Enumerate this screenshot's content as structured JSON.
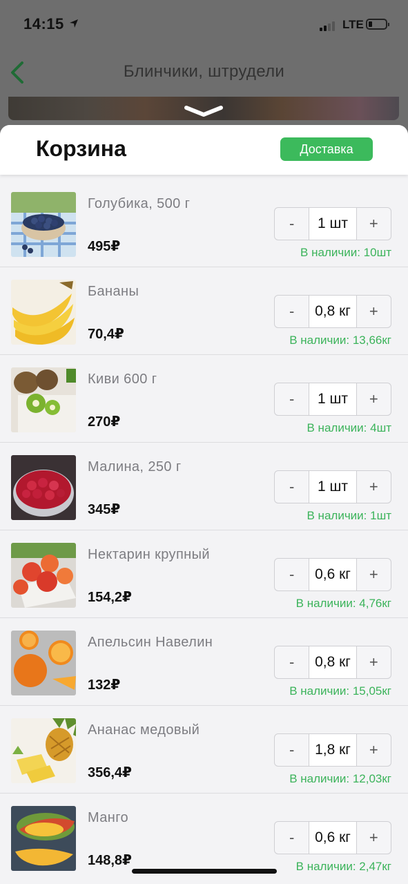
{
  "status_bar": {
    "time": "14:15",
    "network": "LTE"
  },
  "nav": {
    "title": "Блинчики, штрудели"
  },
  "cart": {
    "title": "Корзина",
    "delivery_button": "Доставка",
    "items": [
      {
        "name": "Голубика, 500 г",
        "price": "495₽",
        "quantity": "1 шт",
        "stock": "В наличии: 10шт",
        "image": "blueberry",
        "minus": "-",
        "plus": "+"
      },
      {
        "name": "Бананы",
        "price": "70,4₽",
        "quantity": "0,8 кг",
        "stock": "В наличии: 13,66кг",
        "image": "banana",
        "minus": "-",
        "plus": "+"
      },
      {
        "name": "Киви 600 г",
        "price": "270₽",
        "quantity": "1 шт",
        "stock": "В наличии: 4шт",
        "image": "kiwi",
        "minus": "-",
        "plus": "+"
      },
      {
        "name": "Малина, 250 г",
        "price": "345₽",
        "quantity": "1 шт",
        "stock": "В наличии: 1шт",
        "image": "raspberry",
        "minus": "-",
        "plus": "+"
      },
      {
        "name": "Нектарин крупный",
        "price": "154,2₽",
        "quantity": "0,6 кг",
        "stock": "В наличии: 4,76кг",
        "image": "nectarine",
        "minus": "-",
        "plus": "+"
      },
      {
        "name": "Апельсин Навелин",
        "price": "132₽",
        "quantity": "0,8 кг",
        "stock": "В наличии: 15,05кг",
        "image": "orange",
        "minus": "-",
        "plus": "+"
      },
      {
        "name": "Ананас медовый",
        "price": "356,4₽",
        "quantity": "1,8 кг",
        "stock": "В наличии: 12,03кг",
        "image": "pineapple",
        "minus": "-",
        "plus": "+"
      },
      {
        "name": "Манго",
        "price": "148,8₽",
        "quantity": "0,6 кг",
        "stock": "В наличии: 2,47кг",
        "image": "mango",
        "minus": "-",
        "plus": "+"
      }
    ]
  },
  "colors": {
    "accent_green": "#3cba5c",
    "stock_green": "#3bb35a"
  }
}
